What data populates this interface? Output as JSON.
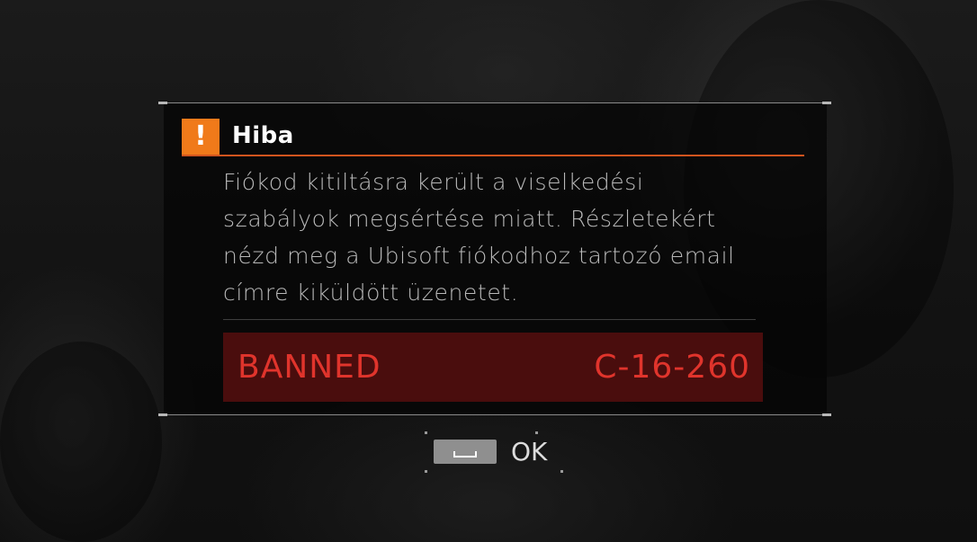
{
  "dialog": {
    "icon": "exclamation-icon",
    "title": "Hiba",
    "message": "Fiókod kitiltásra került a viselkedési szabályok megsértése miatt. Részletekért nézd meg a Ubisoft fiókodhoz tartozó email címre kiküldött üzenetet.",
    "status": "BANNED",
    "error_code": "C-16-260"
  },
  "action": {
    "key_icon": "spacebar-icon",
    "label": "OK"
  },
  "colors": {
    "accent": "#f07a1a",
    "header_rule": "#d2541e",
    "ban_background": "#4a0d0d",
    "ban_text": "#e0342c"
  }
}
